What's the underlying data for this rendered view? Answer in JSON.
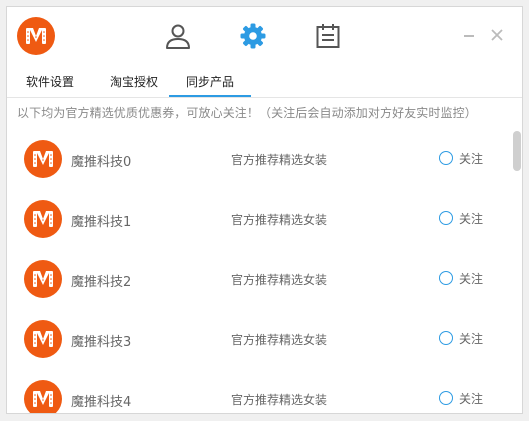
{
  "header": {
    "logo_icon": "m-logo-icon",
    "nav": [
      {
        "name": "user-icon"
      },
      {
        "name": "gear-icon",
        "active": true
      },
      {
        "name": "calendar-icon"
      }
    ],
    "minimize_glyph": "−",
    "close_glyph": "×"
  },
  "tabs": [
    {
      "label": "软件设置"
    },
    {
      "label": "淘宝授权"
    },
    {
      "label": "同步产品",
      "active": true
    }
  ],
  "notice": "以下均为官方精选优质优惠券，可放心关注！（关注后会自动添加对方好友实时监控）",
  "rows": [
    {
      "name": "魔推科技0",
      "desc": "官方推荐精选女装",
      "follow_label": "关注"
    },
    {
      "name": "魔推科技1",
      "desc": "官方推荐精选女装",
      "follow_label": "关注"
    },
    {
      "name": "魔推科技2",
      "desc": "官方推荐精选女装",
      "follow_label": "关注"
    },
    {
      "name": "魔推科技3",
      "desc": "官方推荐精选女装",
      "follow_label": "关注"
    },
    {
      "name": "魔推科技4",
      "desc": "官方推荐精选女装",
      "follow_label": "关注"
    }
  ],
  "colors": {
    "accent": "#2d9be3",
    "brand": "#ef5a12",
    "text": "#666666",
    "notice": "#8a8a8a"
  }
}
